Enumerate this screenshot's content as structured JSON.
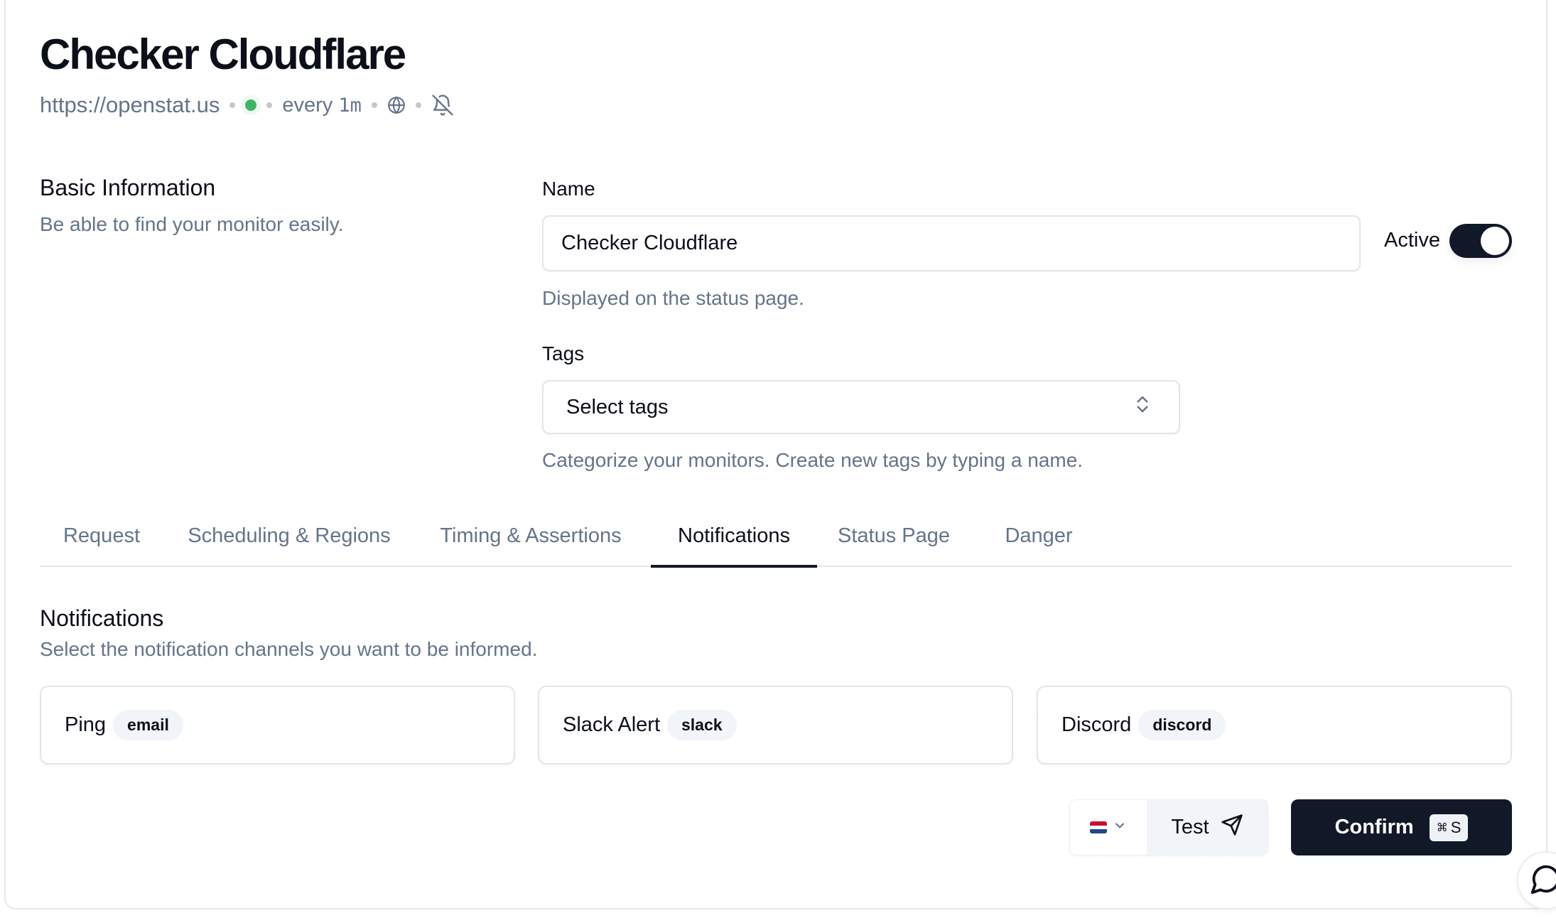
{
  "header": {
    "title": "Checker Cloudflare",
    "url": "https://openstat.us",
    "status": "up",
    "status_color": "#3fb561",
    "interval_prefix": "every",
    "interval_value": "1m",
    "icons": [
      "globe-icon",
      "bell-off-icon"
    ]
  },
  "basic_info": {
    "title": "Basic Information",
    "description": "Be able to find your monitor easily."
  },
  "name_field": {
    "label": "Name",
    "value": "Checker Cloudflare",
    "helper": "Displayed on the status page."
  },
  "active_toggle": {
    "label": "Active",
    "checked": true
  },
  "tags_field": {
    "label": "Tags",
    "placeholder": "Select tags",
    "helper": "Categorize your monitors. Create new tags by typing a name."
  },
  "tabs": [
    {
      "label": "Request",
      "active": false
    },
    {
      "label": "Scheduling & Regions",
      "active": false
    },
    {
      "label": "Timing & Assertions",
      "active": false
    },
    {
      "label": "Notifications",
      "active": true
    },
    {
      "label": "Status Page",
      "active": false
    },
    {
      "label": "Danger",
      "active": false
    }
  ],
  "notifications": {
    "title": "Notifications",
    "description": "Select the notification channels you want to be informed.",
    "channels": [
      {
        "name": "Ping",
        "type": "email"
      },
      {
        "name": "Slack Alert",
        "type": "slack"
      },
      {
        "name": "Discord",
        "type": "discord"
      }
    ]
  },
  "footer": {
    "region_flag": "Netherlands",
    "test_label": "Test",
    "confirm_label": "Confirm",
    "confirm_shortcut_symbol": "⌘",
    "confirm_shortcut_key": "S"
  },
  "colors": {
    "primary": "#111827",
    "muted_text": "#64748b",
    "badge_bg": "#f1f4f8"
  }
}
